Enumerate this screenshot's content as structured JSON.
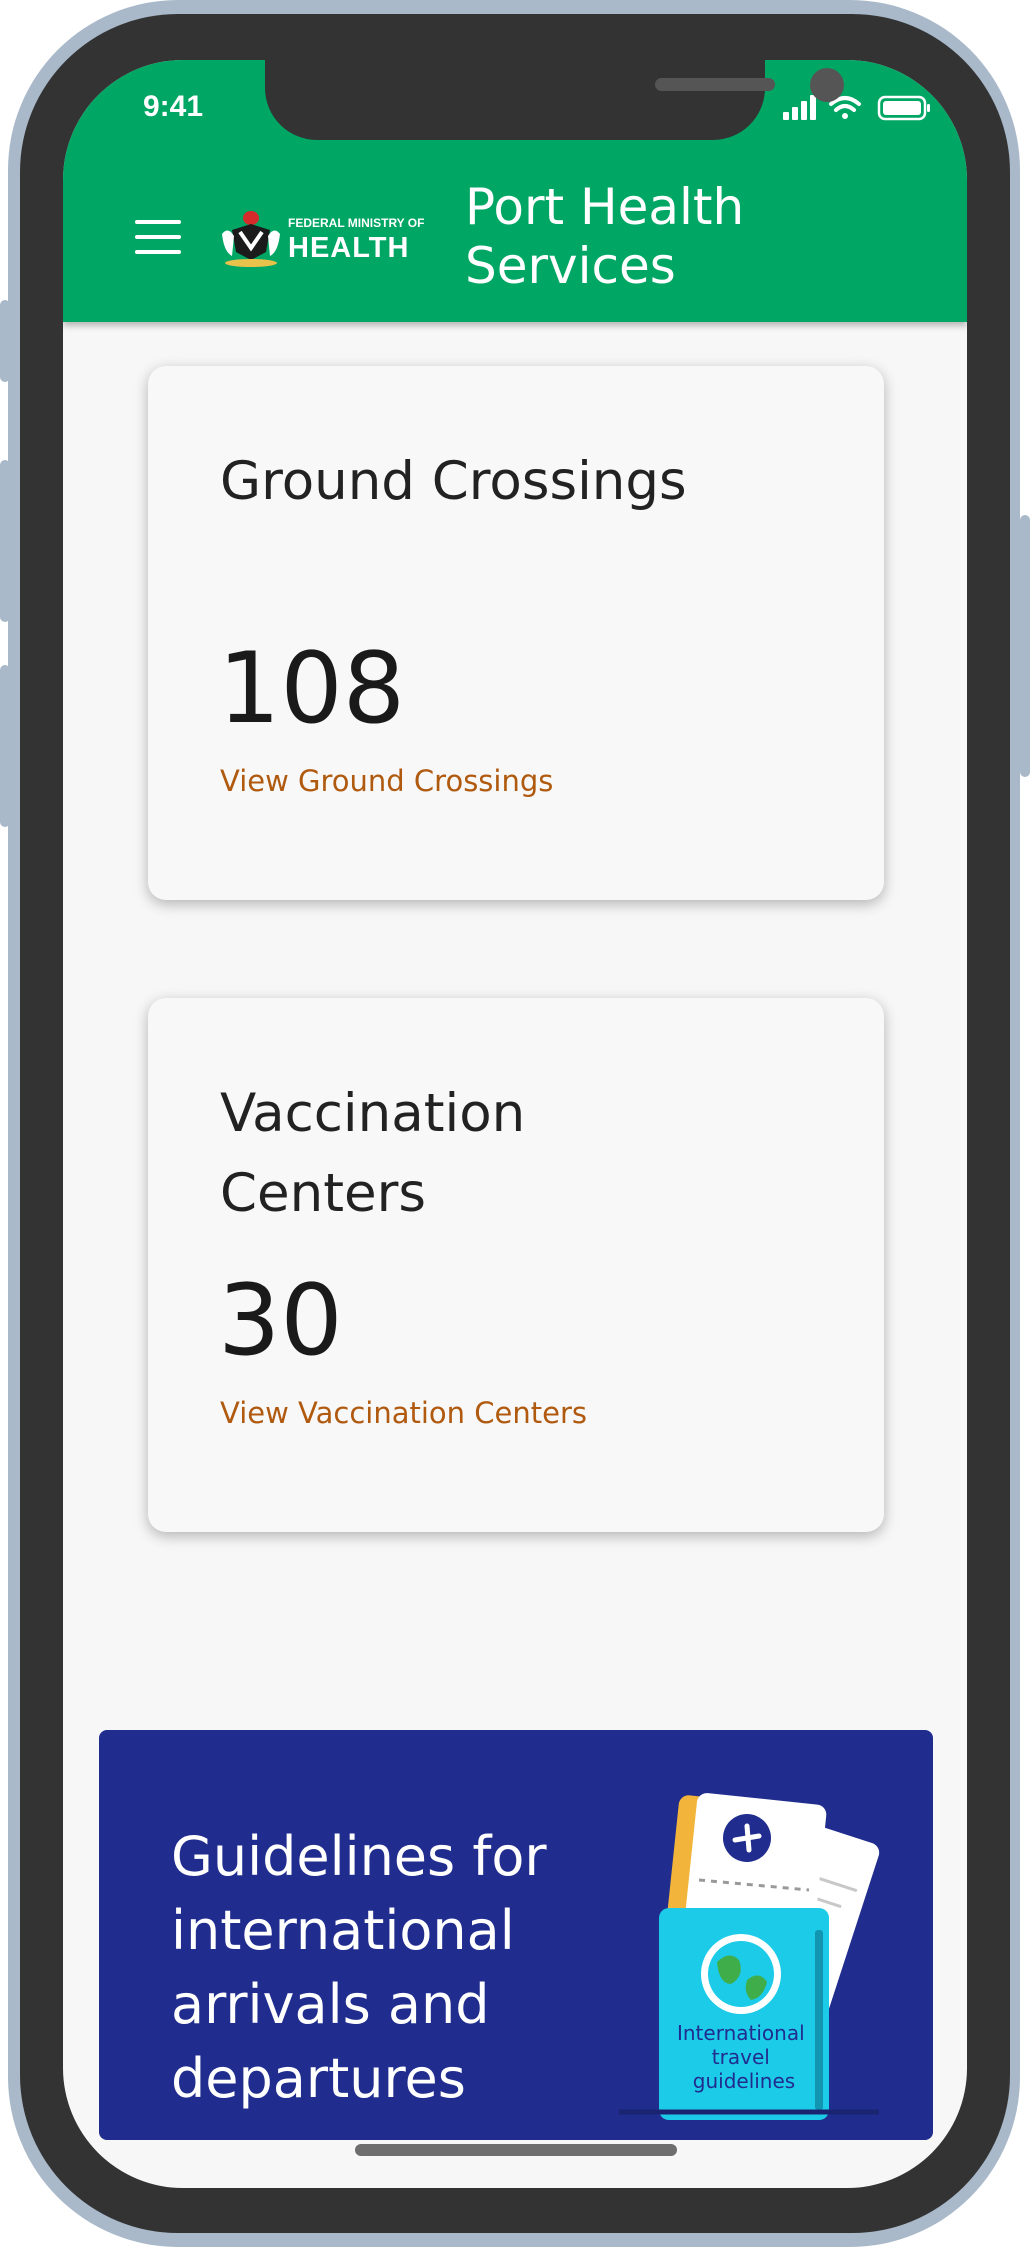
{
  "status_bar": {
    "time": "9:41"
  },
  "header": {
    "logo_top_text": "FEDERAL MINISTRY OF",
    "logo_main_text": "HEALTH",
    "title": "Port Health Services"
  },
  "cards": [
    {
      "title": "Ground Crossings",
      "count": "108",
      "link": "View Ground Crossings"
    },
    {
      "title": "Vaccination Centers",
      "count": "30",
      "link": "View Vaccination Centers"
    }
  ],
  "banner": {
    "headline": "Guidelines for international arrivals and departures",
    "passport_text": "International travel guidelines"
  },
  "colors": {
    "header_green": "#00a664",
    "link_orange": "#b05a10",
    "banner_navy": "#202d8e",
    "passport_cyan": "#1ccbe8"
  }
}
